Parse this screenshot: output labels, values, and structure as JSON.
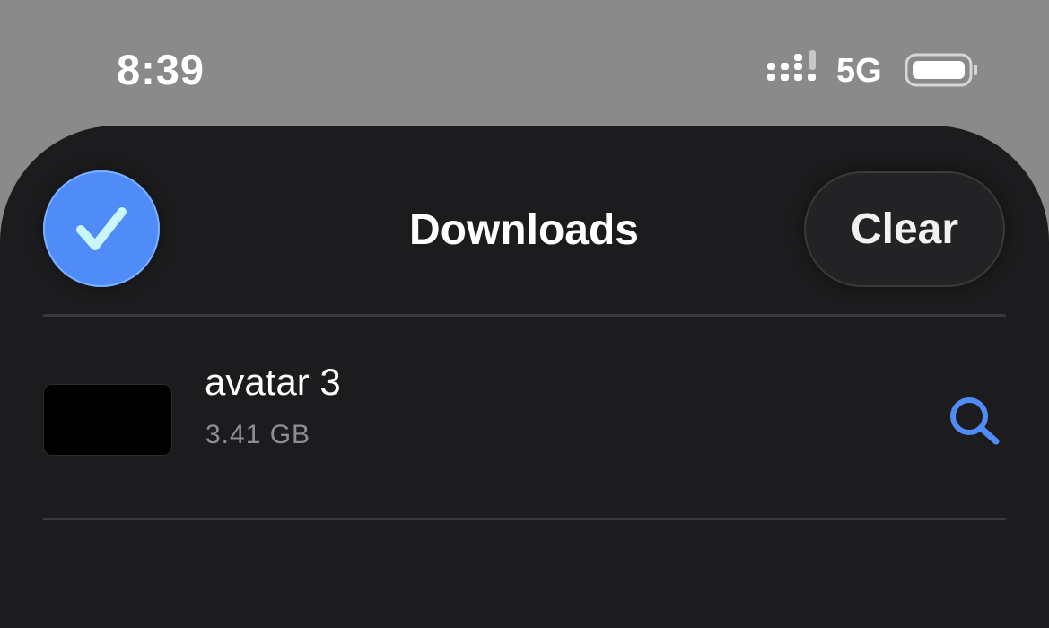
{
  "status_bar": {
    "time": "8:39",
    "network": "5G",
    "signal_icon": "signal-bars-icon",
    "battery_icon": "battery-icon"
  },
  "header": {
    "select_icon": "checkmark-icon",
    "title": "Downloads",
    "clear_label": "Clear"
  },
  "downloads": [
    {
      "name": "avatar 3",
      "size": "3.41 GB",
      "action_icon": "search-icon"
    }
  ],
  "colors": {
    "accent": "#4f8cf7",
    "sheet_background": "#1c1c1e",
    "status_background": "#8a8a8a",
    "secondary_text": "#8e8e93"
  }
}
